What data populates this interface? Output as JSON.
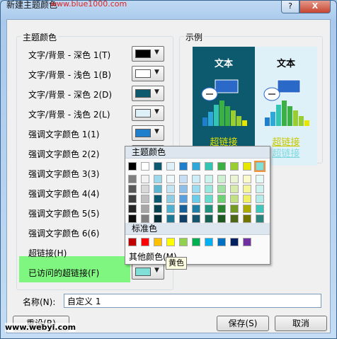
{
  "window": {
    "title": "新建主题颜色",
    "watermark_top": "www.blue1000.com",
    "help_label": "?",
    "close_label": "X"
  },
  "theme_colors": {
    "group_title": "主题颜色",
    "rows": [
      {
        "label": "文字/背景 - 深色 1(T)",
        "color": "#000000"
      },
      {
        "label": "文字/背景 - 浅色 1(B)",
        "color": "#ffffff"
      },
      {
        "label": "文字/背景 - 深色 2(D)",
        "color": "#0d5a6e"
      },
      {
        "label": "文字/背景 - 浅色 2(L)",
        "color": "#def1f8"
      },
      {
        "label": "强调文字颜色 1(1)",
        "color": "#1f7fcc"
      },
      {
        "label": "强调文字颜色 2(2)",
        "color": "#2ea8d9"
      },
      {
        "label": "强调文字颜色 3(3)",
        "color": "#34c4b4"
      },
      {
        "label": "强调文字颜色 4(4)",
        "color": "#3cb043"
      },
      {
        "label": "强调文字颜色 5(5)",
        "color": "#9acd32"
      },
      {
        "label": "强调文字颜色 6(6)",
        "color": "#e6e600"
      },
      {
        "label": "超链接(H)",
        "color": "#e6e600"
      },
      {
        "label": "已访问的超链接(F)",
        "color": "#80e0d8"
      }
    ]
  },
  "sample": {
    "group_title": "示例",
    "dark_text": "文本",
    "light_text": "文本",
    "dark_link": "超链接",
    "light_link": "超链接",
    "visited_link": "超链接",
    "dark_link_color": "#e6e600",
    "light_link_color": "#c8c800"
  },
  "dropdown": {
    "theme_header": "主题颜色",
    "standard_header": "标准色",
    "more_colors": "其他颜色(M)...",
    "tooltip": "黄色",
    "theme_top_row": [
      "#000000",
      "#ffffff",
      "#0d5a6e",
      "#def1f8",
      "#1f7fcc",
      "#2ea8d9",
      "#34c4b4",
      "#3cb043",
      "#9acd32",
      "#e6e600",
      "#80e0d8"
    ],
    "theme_shades": [
      [
        "#7f7f7f",
        "#595959",
        "#404040",
        "#262626",
        "#0d0d0d"
      ],
      [
        "#f2f2f2",
        "#d9d9d9",
        "#bfbfbf",
        "#a6a6a6",
        "#808080"
      ],
      [
        "#9dd9ea",
        "#5fb7cf",
        "#0d5a6e",
        "#0a4352",
        "#072d37"
      ],
      [
        "#eef8fb",
        "#c3e6f2",
        "#8fcde2",
        "#4fb0d0",
        "#1e7894"
      ],
      [
        "#c6dff4",
        "#8ebfe9",
        "#5a9fdd",
        "#175f99",
        "#0f3f66"
      ],
      [
        "#cdeef8",
        "#9cdcf1",
        "#6acbea",
        "#1f7ea3",
        "#15546d"
      ],
      [
        "#cdf3ee",
        "#9ae7dd",
        "#68dbcc",
        "#23937f",
        "#176255"
      ],
      [
        "#cff0d1",
        "#9fe1a3",
        "#6ed275",
        "#2a8430",
        "#1c5820"
      ],
      [
        "#ebf5d6",
        "#d7ebad",
        "#c2e184",
        "#739a25",
        "#4d6718"
      ],
      [
        "#fafacc",
        "#f5f599",
        "#f0f066",
        "#acac00",
        "#737300"
      ],
      [
        "#e5f9f7",
        "#ccf3ef",
        "#b3ece8",
        "#3ec6ba",
        "#2a847c"
      ]
    ],
    "standard_colors": [
      "#c00000",
      "#ff0000",
      "#ffc000",
      "#ffff00",
      "#92d050",
      "#00b050",
      "#00b0f0",
      "#0070c0",
      "#002060",
      "#7030a0"
    ]
  },
  "name_field": {
    "label": "名称(N):",
    "value": "自定义 1"
  },
  "buttons": {
    "reset": "重设(R)",
    "save": "保存(S)",
    "cancel": "取消"
  },
  "watermark_bottom": "www.webyi.com"
}
